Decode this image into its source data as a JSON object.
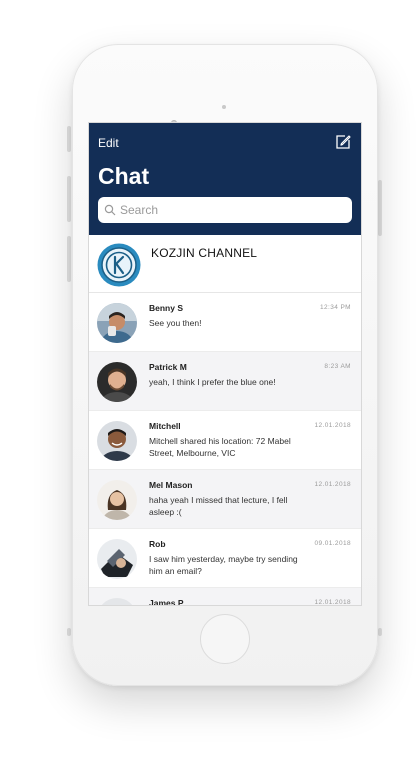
{
  "header": {
    "edit_label": "Edit",
    "title": "Chat",
    "search_placeholder": "Search",
    "background_color": "#132e56"
  },
  "channel": {
    "name": "KOZJIN CHANNEL",
    "logo_icon": "kozjin-logo-icon"
  },
  "chats": [
    {
      "name": "Benny S",
      "message": "See you then!",
      "time": "12:34 PM"
    },
    {
      "name": "Patrick M",
      "message": "yeah, I think I prefer the blue one!",
      "time": "8:23 AM"
    },
    {
      "name": "Mitchell",
      "message": "Mitchell shared his location: 72 Mabel Street, Melbourne, VIC",
      "time": "12.01.2018"
    },
    {
      "name": "Mel Mason",
      "message": "haha yeah I missed that lecture, I fell asleep :(",
      "time": "12.01.2018"
    },
    {
      "name": "Rob",
      "message": "I saw him yesterday, maybe try sending him an email?",
      "time": "09.01.2018"
    },
    {
      "name": "James P",
      "message": "",
      "time": "12.01.2018"
    }
  ]
}
